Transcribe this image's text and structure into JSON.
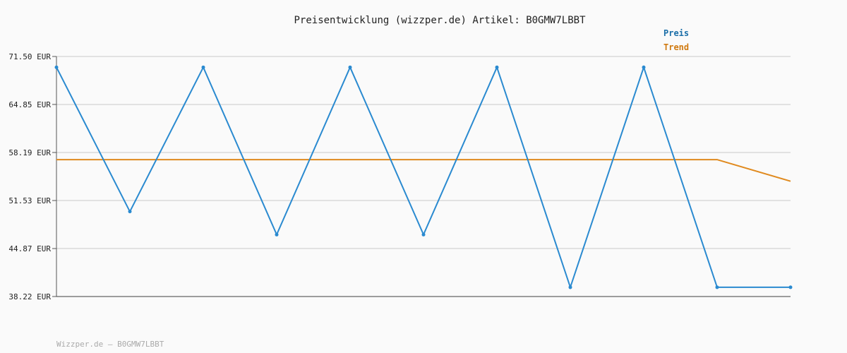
{
  "chart_data": {
    "type": "line",
    "title": "Preisentwicklung (wizzper.de) Artikel: B0GMW7LBBT",
    "ylim": [
      38.22,
      71.5
    ],
    "yticks": [
      "71.50 EUR",
      "64.85 EUR",
      "58.19 EUR",
      "51.53 EUR",
      "44.87 EUR",
      "38.22 EUR"
    ],
    "ytick_values": [
      71.5,
      64.85,
      58.19,
      51.53,
      44.87,
      38.22
    ],
    "x": [
      0,
      1,
      2,
      3,
      4,
      5,
      6,
      7,
      8,
      9,
      10
    ],
    "grid": true,
    "legend_position": "top-right",
    "series": [
      {
        "name": "Preis",
        "color": "#2a8ad0",
        "markers": true,
        "values": [
          70.0,
          50.0,
          70.0,
          46.8,
          70.0,
          46.8,
          70.0,
          39.5,
          70.0,
          39.5,
          39.5
        ]
      },
      {
        "name": "Trend",
        "color": "#e08a1e",
        "markers": false,
        "values": [
          57.2,
          57.2,
          57.2,
          57.2,
          57.2,
          57.2,
          57.2,
          57.2,
          57.2,
          57.2,
          54.2
        ]
      }
    ],
    "footer": "Wizzper.de – B0GMW7LBBT",
    "legend_colors": {
      "Preis": "#1a6ea8",
      "Trend": "#d07a10"
    }
  }
}
